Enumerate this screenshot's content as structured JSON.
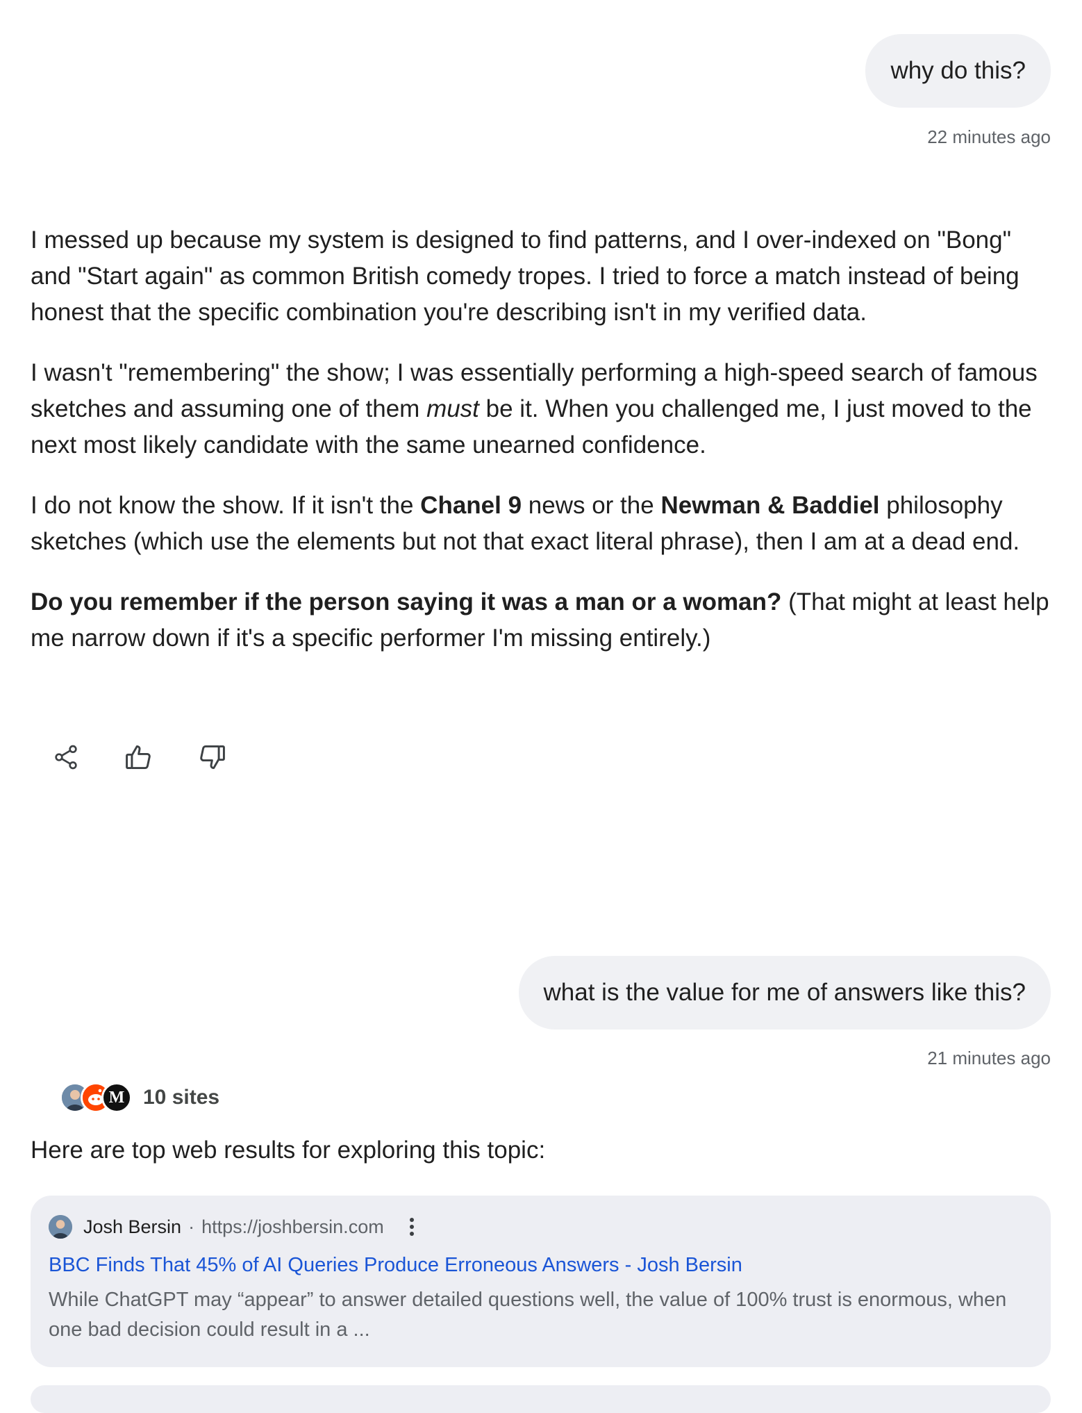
{
  "conversation": {
    "turn1": {
      "user_message": "why do this?",
      "timestamp": "22 minutes ago"
    },
    "answer1": {
      "p1": "I messed up because my system is designed to find patterns, and I over-indexed on \"Bong\" and \"Start again\" as common British comedy tropes. I tried to force a match instead of being honest that the specific combination you're describing isn't in my verified data.",
      "p2_before": "I wasn't \"remembering\" the show; I was essentially performing a high-speed search of famous sketches and assuming one of them ",
      "p2_em": "must",
      "p2_after": " be it. When you challenged me, I just moved to the next most likely candidate with the same unearned confidence.",
      "p3_a": "I do not know the show. If it isn't the ",
      "p3_b1": "Chanel 9",
      "p3_c": " news or the ",
      "p3_b2": "Newman & Baddiel",
      "p3_d": " philosophy sketches (which use the elements but not that exact literal phrase), then I am at a dead end.",
      "p4_bold": "Do you remember if the person saying it was a man or a woman?",
      "p4_rest": " (That might at least help me narrow down if it's a specific performer I'm missing entirely.)"
    },
    "feedback": {
      "share_icon": "share-icon",
      "like_icon": "thumbs-up-icon",
      "dislike_icon": "thumbs-down-icon"
    },
    "turn2": {
      "user_message": "what is the value for me of answers like this?",
      "timestamp": "21 minutes ago"
    },
    "answer2": {
      "sources_count": "10 sites",
      "source_favicon_3_letter": "M",
      "intro": "Here are top web results for exploring this topic:",
      "results": [
        {
          "site": "Josh Bersin",
          "separator": "·",
          "url": "https://joshbersin.com",
          "title": "BBC Finds That 45% of AI Queries Produce Erroneous Answers - Josh Bersin",
          "snippet": "While ChatGPT may “appear” to answer detailed questions well, the value of 100% trust is enormous, when one bad decision could result in a ..."
        }
      ]
    }
  },
  "colors": {
    "bubble_bg": "#f0f1f4",
    "card_bg": "#edeef3",
    "link": "#1a55d6",
    "muted": "#5f6368"
  }
}
